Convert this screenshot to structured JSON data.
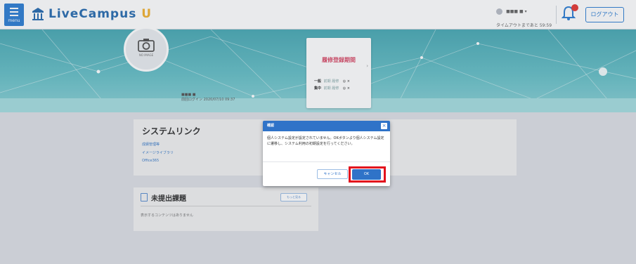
{
  "colors": {
    "brand_blue": "#2f7fd3",
    "accent_yellow": "#f2b233",
    "hero_teal": "#67c0c7",
    "alert_red": "#e3121d",
    "badge_red": "#e53935"
  },
  "header": {
    "menu_label": "menu",
    "logo_text": "LiveCampus",
    "logo_suffix": "U",
    "user_name": "■■■ ■ ▾",
    "timeout_text": "タイムアウトまであと 59:59",
    "logout_label": "ログアウト",
    "notification_icon": "bell-icon"
  },
  "hero": {
    "noimage_label": "NO IMAGE",
    "user_id": "■■■ ■",
    "last_login": "前回ログイン 2020/07/10 09:37",
    "registration_card": {
      "title": "履修登録期間",
      "rows": [
        {
          "label": "一般",
          "period": "前期 履修",
          "mark": "◎ ×"
        },
        {
          "label": "集中",
          "period": "前期 履修",
          "mark": "◎ ×"
        }
      ]
    }
  },
  "system_links": {
    "title": "システムリンク",
    "links": [
      "成績管理等",
      "イメージライブラリ",
      "Office365"
    ]
  },
  "tasks": {
    "title": "未提出課題",
    "more_button": "もっと見る",
    "empty_message": "表示するコンテンツはありません"
  },
  "dialog": {
    "title": "確認",
    "close_icon": "close-icon",
    "message": "個人システム設定が設定されていません。OKボタンより個人システム設定に遷移し、システム利用の初期設定を行ってください。",
    "cancel_label": "キャンセル",
    "ok_label": "OK"
  }
}
